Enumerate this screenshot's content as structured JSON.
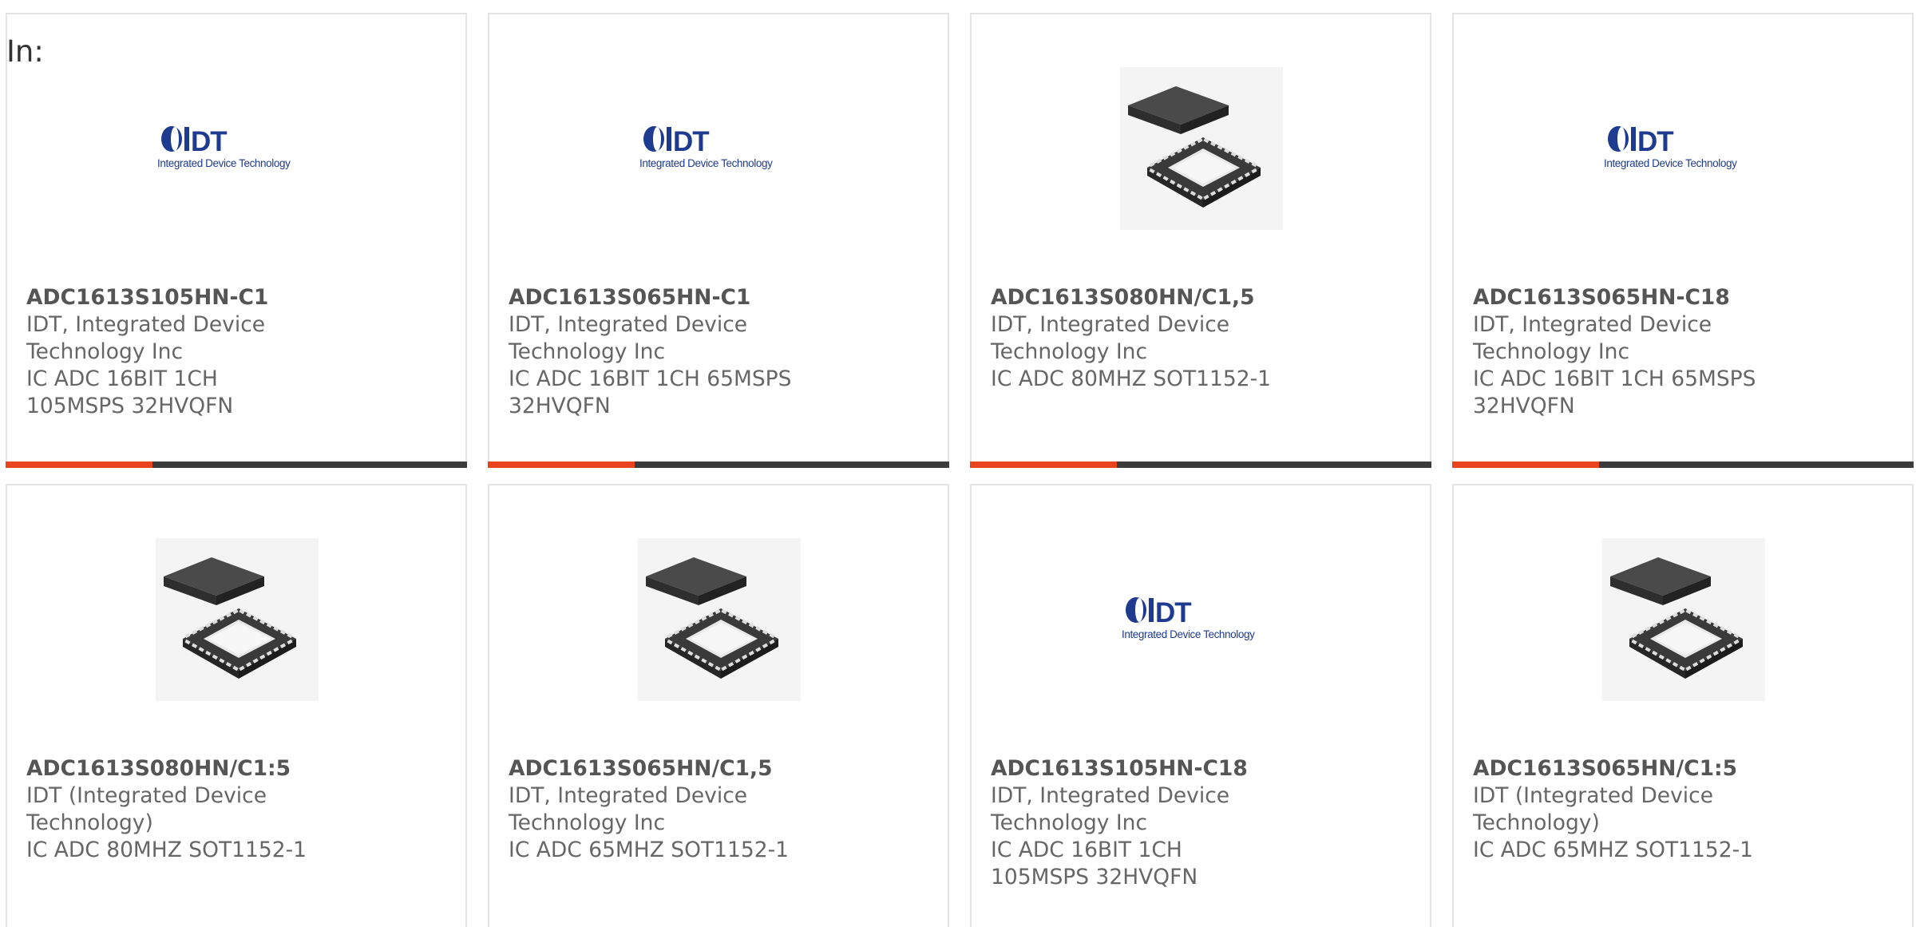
{
  "filter_label": "In:",
  "products": [
    {
      "part_number": "ADC1613S105HN-C1",
      "manufacturer": "IDT, Integrated Device Technology Inc",
      "description": "IC ADC 16BIT 1CH 105MSPS 32HVQFN",
      "image": "idt-logo"
    },
    {
      "part_number": "ADC1613S065HN-C1",
      "manufacturer": "IDT, Integrated Device Technology Inc",
      "description": "IC ADC 16BIT 1CH 65MSPS 32HVQFN",
      "image": "idt-logo"
    },
    {
      "part_number": "ADC1613S080HN/C1,5",
      "manufacturer": "IDT, Integrated Device Technology Inc",
      "description": "IC ADC 80MHZ SOT1152-1",
      "image": "qfn-chip"
    },
    {
      "part_number": "ADC1613S065HN-C18",
      "manufacturer": "IDT, Integrated Device Technology Inc",
      "description": "IC ADC 16BIT 1CH 65MSPS 32HVQFN",
      "image": "idt-logo"
    },
    {
      "part_number": "ADC1613S080HN/C1:5",
      "manufacturer": "IDT (Integrated Device Technology)",
      "description": "IC ADC 80MHZ SOT1152-1",
      "image": "qfn-chip"
    },
    {
      "part_number": "ADC1613S065HN/C1,5",
      "manufacturer": "IDT, Integrated Device Technology Inc",
      "description": "IC ADC 65MHZ SOT1152-1",
      "image": "qfn-chip"
    },
    {
      "part_number": "ADC1613S105HN-C18",
      "manufacturer": "IDT, Integrated Device Technology Inc",
      "description": "IC ADC 16BIT 1CH 105MSPS 32HVQFN",
      "image": "idt-logo"
    },
    {
      "part_number": "ADC1613S065HN/C1:5",
      "manufacturer": "IDT (Integrated Device Technology)",
      "description": "IC ADC 65MHZ SOT1152-1",
      "image": "qfn-chip"
    }
  ],
  "logo": {
    "mark": "IDT",
    "tagline": "Integrated Device Technology"
  },
  "colors": {
    "accent": "#e8441e",
    "bar": "#3b3b3b",
    "logo_blue": "#1f3b8f"
  }
}
